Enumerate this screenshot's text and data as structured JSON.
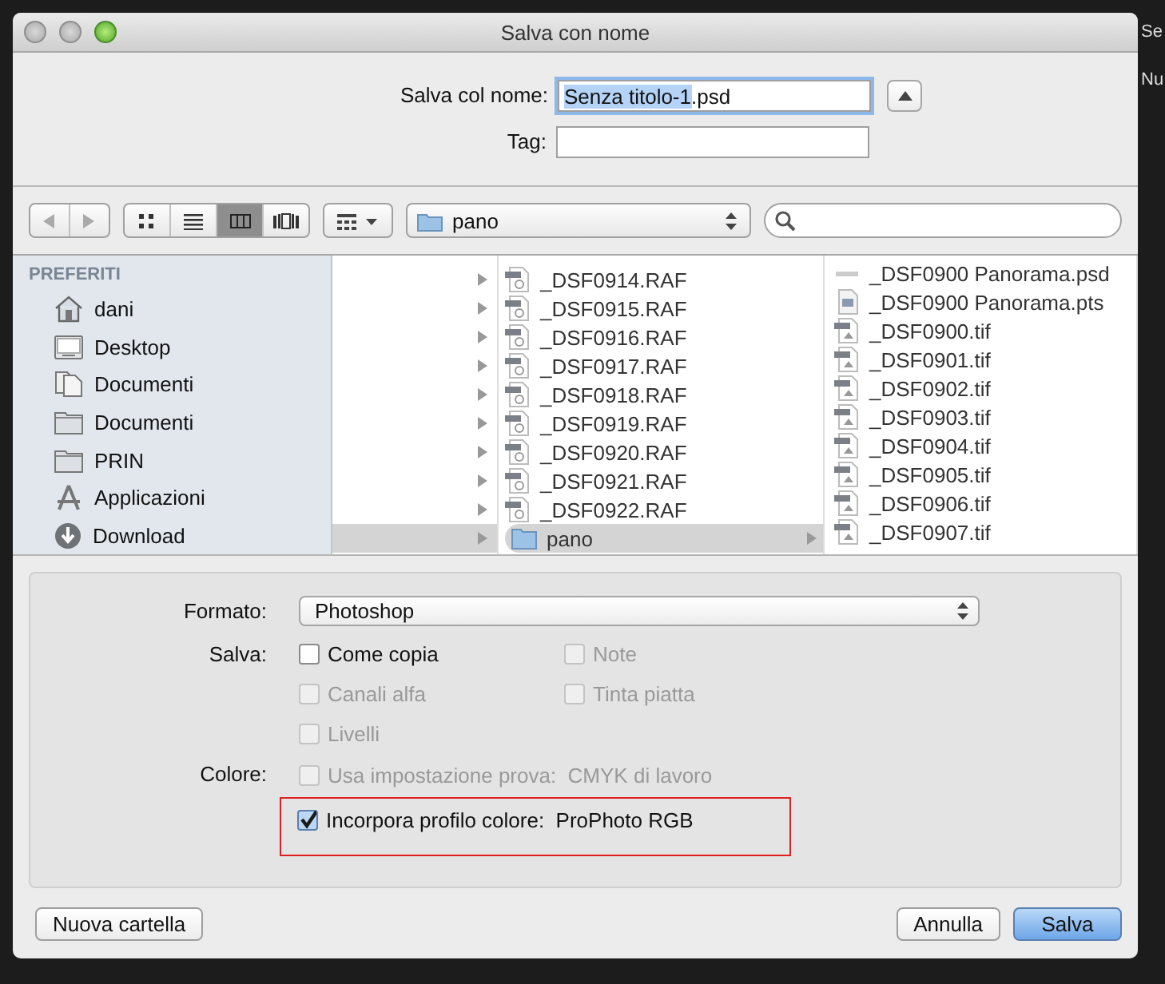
{
  "background_app": {
    "texts": [
      "Se",
      "Nu"
    ]
  },
  "window": {
    "title": "Salva con nome"
  },
  "name_row": {
    "label": "Salva col nome:",
    "selected_text": "Senza titolo-1",
    "rest_text": ".psd",
    "expanded": false
  },
  "tag_row": {
    "label": "Tag:"
  },
  "toolbar": {
    "views": [
      {
        "kind": "icons",
        "selected": false
      },
      {
        "kind": "list",
        "selected": false
      },
      {
        "kind": "columns",
        "selected": true
      },
      {
        "kind": "coverflow",
        "selected": false
      }
    ],
    "path": "pano"
  },
  "sidebar": {
    "header": "PREFERITI",
    "items": [
      {
        "label": "dani",
        "kind": "home"
      },
      {
        "label": "Desktop",
        "kind": "desktop"
      },
      {
        "label": "Documenti",
        "kind": "documents"
      },
      {
        "label": "Documenti",
        "kind": "folder"
      },
      {
        "label": "PRIN",
        "kind": "folder"
      },
      {
        "label": "Applicazioni",
        "kind": "apps"
      },
      {
        "label": "Download",
        "kind": "download"
      }
    ]
  },
  "column_1": [
    {
      "selected": false
    },
    {
      "selected": false
    },
    {
      "selected": false
    },
    {
      "selected": false
    },
    {
      "selected": false
    },
    {
      "selected": false
    },
    {
      "selected": false
    },
    {
      "selected": false
    },
    {
      "selected": false
    },
    {
      "selected": true
    }
  ],
  "column_2": [
    {
      "name": "_DSF0914.RAF",
      "kind": "raw",
      "selected": false
    },
    {
      "name": "_DSF0915.RAF",
      "kind": "raw",
      "selected": false
    },
    {
      "name": "_DSF0916.RAF",
      "kind": "raw",
      "selected": false
    },
    {
      "name": "_DSF0917.RAF",
      "kind": "raw",
      "selected": false
    },
    {
      "name": "_DSF0918.RAF",
      "kind": "raw",
      "selected": false
    },
    {
      "name": "_DSF0919.RAF",
      "kind": "raw",
      "selected": false
    },
    {
      "name": "_DSF0920.RAF",
      "kind": "raw",
      "selected": false
    },
    {
      "name": "_DSF0921.RAF",
      "kind": "raw",
      "selected": false
    },
    {
      "name": "_DSF0922.RAF",
      "kind": "raw",
      "selected": false
    },
    {
      "name": "pano",
      "kind": "folder",
      "selected": true
    }
  ],
  "column_3": [
    {
      "name": "_DSF0900 Panorama.psd",
      "kind": "psd"
    },
    {
      "name": "_DSF0900 Panorama.pts",
      "kind": "pts"
    },
    {
      "name": "_DSF0900.tif",
      "kind": "tif"
    },
    {
      "name": "_DSF0901.tif",
      "kind": "tif"
    },
    {
      "name": "_DSF0902.tif",
      "kind": "tif"
    },
    {
      "name": "_DSF0903.tif",
      "kind": "tif"
    },
    {
      "name": "_DSF0904.tif",
      "kind": "tif"
    },
    {
      "name": "_DSF0905.tif",
      "kind": "tif"
    },
    {
      "name": "_DSF0906.tif",
      "kind": "tif"
    },
    {
      "name": "_DSF0907.tif",
      "kind": "tif"
    }
  ],
  "options": {
    "format_label": "Formato:",
    "format_value": "Photoshop",
    "save_group": {
      "label": "Salva:",
      "checks": [
        {
          "label": "Come copia",
          "checked": false,
          "disabled": false
        },
        {
          "label": "Note",
          "checked": false,
          "disabled": true
        },
        {
          "label": "Canali alfa",
          "checked": false,
          "disabled": true
        },
        {
          "label": "Tinta piatta",
          "checked": false,
          "disabled": true
        },
        {
          "label": "Livelli",
          "checked": false,
          "disabled": true
        }
      ]
    },
    "color_group": {
      "label": "Colore:",
      "checks": [
        {
          "label": "Usa impostazione prova:",
          "value": "CMYK di lavoro",
          "checked": false,
          "disabled": true,
          "highlighted": false
        },
        {
          "label": "Incorpora profilo colore:",
          "value": "ProPhoto RGB",
          "checked": true,
          "disabled": false,
          "highlighted": true
        }
      ]
    }
  },
  "buttons": {
    "new_folder": "Nuova cartella",
    "cancel": "Annulla",
    "save": "Salva"
  }
}
